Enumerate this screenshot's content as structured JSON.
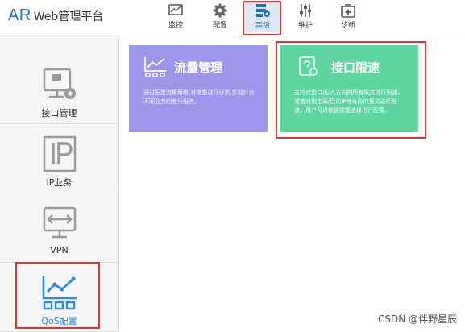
{
  "brand": {
    "logo": "AR",
    "name": "Web管理平台"
  },
  "nav": [
    {
      "label": "监控",
      "icon": "monitor-icon"
    },
    {
      "label": "配置",
      "icon": "gear-icon"
    },
    {
      "label": "高级",
      "icon": "advanced-icon",
      "active": true
    },
    {
      "label": "维护",
      "icon": "sliders-icon"
    },
    {
      "label": "诊断",
      "icon": "medkit-icon"
    }
  ],
  "sidebar": {
    "items": [
      {
        "label": "接口管理",
        "icon": "interface-gear-icon"
      },
      {
        "label": "IP业务",
        "icon": "ip-icon"
      },
      {
        "label": "VPN",
        "icon": "vpn-icon"
      },
      {
        "label": "QoS配置",
        "icon": "qos-chart-icon",
        "active": true
      }
    ]
  },
  "cards": [
    {
      "title": "流量管理",
      "icon": "traffic-chart-icon",
      "desc": "通过配置流量策略,对流量进行分类,实现针对不同业务的差分服务。"
    },
    {
      "title": "接口限速",
      "icon": "interface-limit-icon",
      "desc": "支持对接口出/入方向的所有报文进行限速，或者对指定源/目的IP地址段的报文进行限速，用户可以根据需要选择进行配置。"
    }
  ],
  "colors": {
    "brand_blue": "#1e6fcf",
    "card_purple": "#9d96ea",
    "card_green": "#5ed49f",
    "highlight_red": "#e8322f",
    "qos_blue": "#2a8de0"
  },
  "watermark": "CSDN @伴野星辰"
}
